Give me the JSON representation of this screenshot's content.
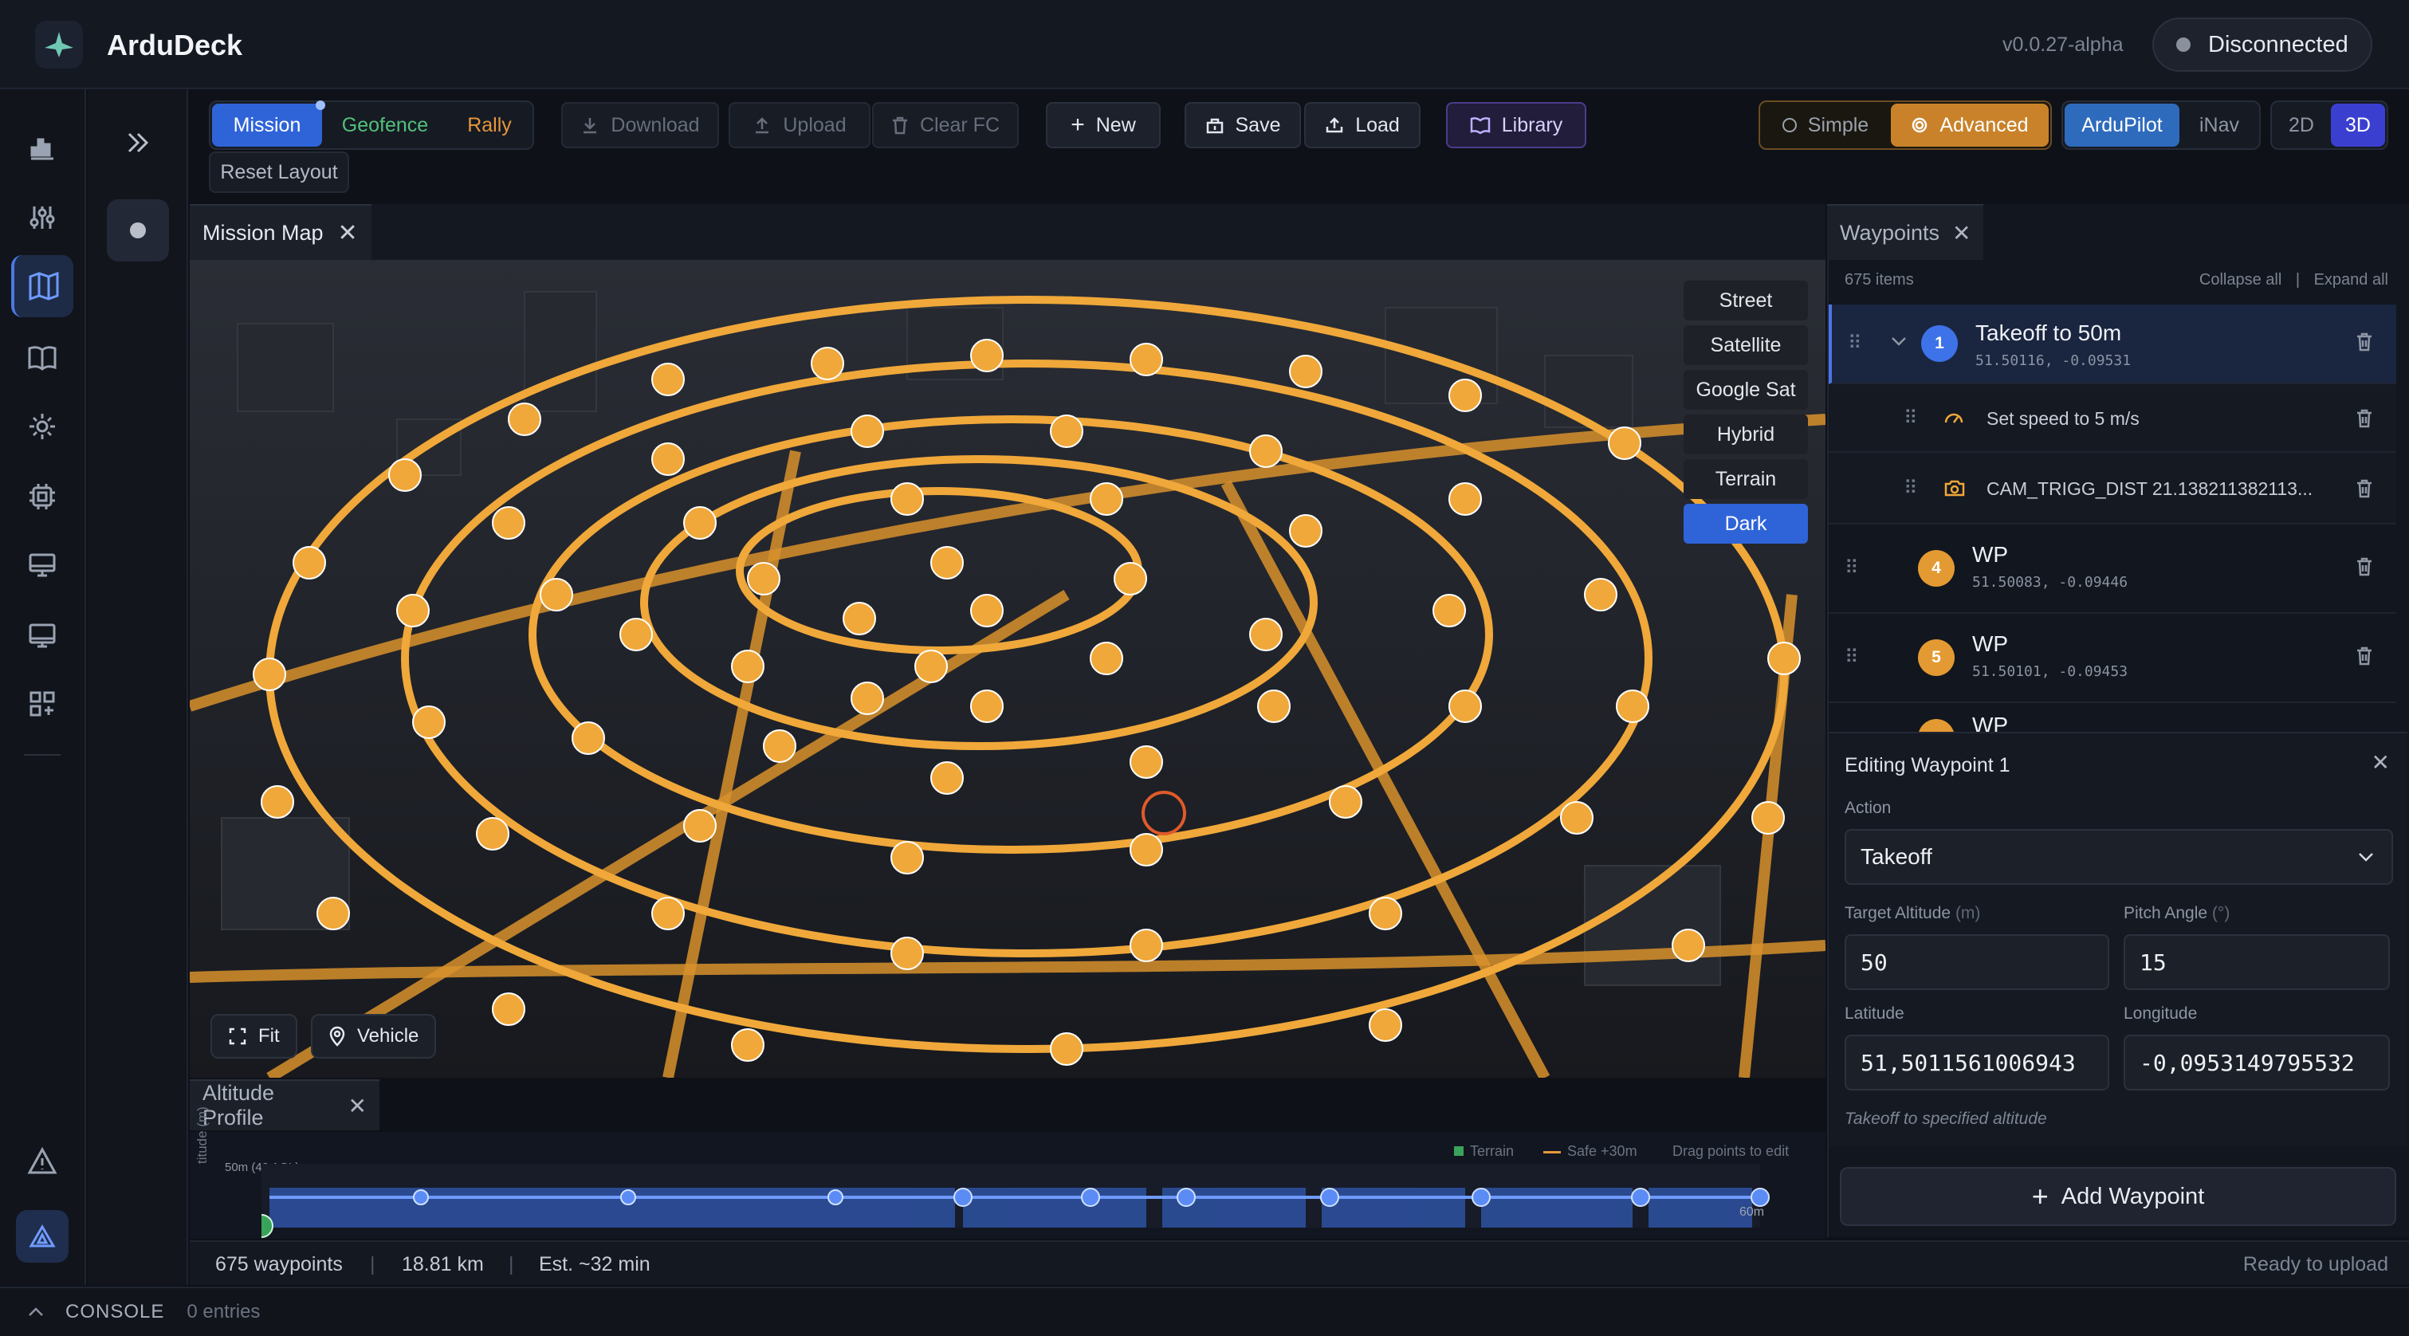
{
  "app": {
    "title": "ArduDeck",
    "version": "v0.0.27-alpha",
    "connection": "Disconnected"
  },
  "tabs": {
    "mission": "Mission",
    "geofence": "Geofence",
    "rally": "Rally"
  },
  "toolbar": {
    "download": "Download",
    "upload": "Upload",
    "clear_fc": "Clear FC",
    "new": "New",
    "save": "Save",
    "load": "Load",
    "library": "Library",
    "reset_layout": "Reset Layout",
    "simple": "Simple",
    "advanced": "Advanced",
    "ardupilot": "ArduPilot",
    "inav": "iNav",
    "view_2d": "2D",
    "view_3d": "3D"
  },
  "colors": {
    "accent": "#2f64d8",
    "waypoint": "#f0a83a",
    "advanced": "#c9822a",
    "background": "#0e1118"
  },
  "sidebar_icons": [
    "chart-icon",
    "sliders-icon",
    "map-icon",
    "book-icon",
    "gear-icon",
    "chip-icon",
    "terminal-icon",
    "monitor-icon",
    "modules-icon",
    "warning-icon",
    "logo-icon"
  ],
  "map": {
    "tab": "Mission Map",
    "layers": [
      "Street",
      "Satellite",
      "Google Sat",
      "Hybrid",
      "Terrain",
      "Dark"
    ],
    "active_layer": "Dark",
    "fit": "Fit",
    "vehicle": "Vehicle"
  },
  "waypoints": {
    "tab": "Waypoints",
    "count": "675 items",
    "collapse_all": "Collapse all",
    "expand_all": "Expand all",
    "items": [
      {
        "num": "1",
        "title": "Takeoff to 50m",
        "coords": "51.50116, -0.09531"
      },
      {
        "title": "Set speed to 5 m/s"
      },
      {
        "title": "CAM_TRIGG_DIST 21.138211382113..."
      },
      {
        "num": "4",
        "title": "WP",
        "coords": "51.50083, -0.09446"
      },
      {
        "num": "5",
        "title": "WP",
        "coords": "51.50101, -0.09453"
      },
      {
        "title": "WP"
      }
    ]
  },
  "editor": {
    "title": "Editing Waypoint 1",
    "action_label": "Action",
    "action_value": "Takeoff",
    "target_alt_label": "Target Altitude",
    "target_alt_unit": "(m)",
    "target_alt_value": "50",
    "pitch_label": "Pitch Angle",
    "pitch_unit": "(°)",
    "pitch_value": "15",
    "lat_label": "Latitude",
    "lat_value": "51,5011561006943",
    "lon_label": "Longitude",
    "lon_value": "-0,0953149795532",
    "hint": "Takeoff to specified altitude",
    "add_button": "Add Waypoint"
  },
  "altitude": {
    "tab": "Altitude Profile",
    "ylabel": "titude (m)",
    "legend_terrain": "Terrain",
    "legend_safe": "Safe +30m",
    "drag_hint": "Drag points to edit",
    "top_label": "50m (42 AGL)",
    "end_label": "60m"
  },
  "status": {
    "waypoints": "675 waypoints",
    "distance": "18.81 km",
    "time": "Est. ~32 min",
    "ready": "Ready to upload"
  },
  "console": {
    "label": "CONSOLE",
    "entries": "0 entries"
  }
}
